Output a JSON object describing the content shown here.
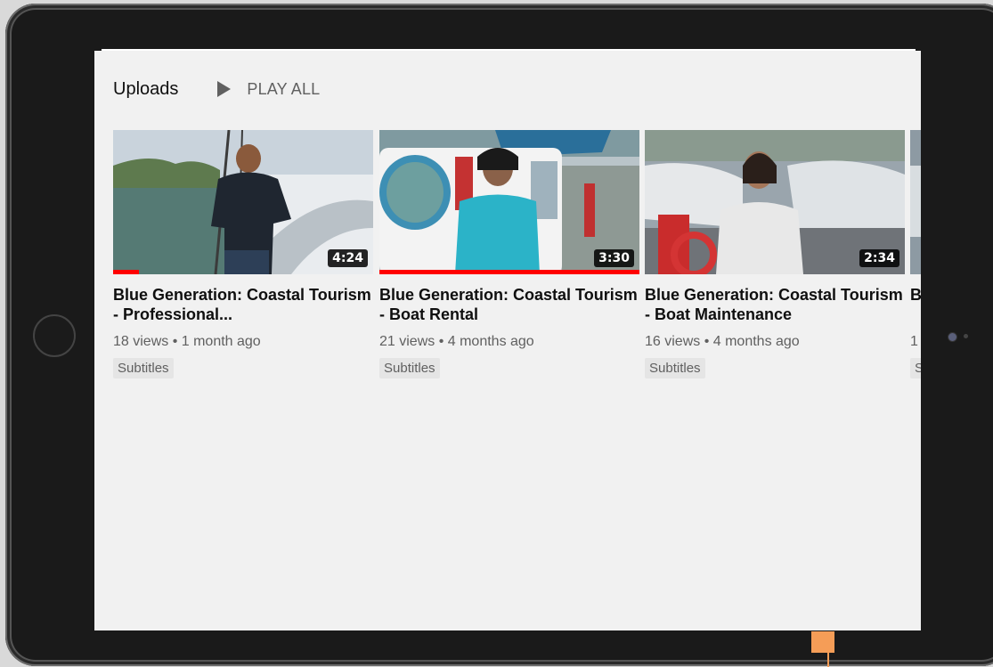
{
  "section": {
    "title": "Uploads",
    "play_all_label": "PLAY ALL"
  },
  "videos": [
    {
      "title": "Blue Generation: Coastal Tourism - Professional...",
      "duration": "4:24",
      "views": "18 views",
      "age": "1 month ago",
      "badge": "Subtitles",
      "watched_fraction": 0.1
    },
    {
      "title": "Blue Generation: Coastal Tourism - Boat Rental",
      "duration": "3:30",
      "views": "21 views",
      "age": "4 months ago",
      "badge": "Subtitles",
      "watched_fraction": 1.0
    },
    {
      "title": "Blue Generation: Coastal Tourism - Boat Maintenance",
      "duration": "2:34",
      "views": "16 views",
      "age": "4 months ago",
      "badge": "Subtitles",
      "watched_fraction": 0.0
    },
    {
      "title": "Blue Generation: Coastal Tourism",
      "duration": "",
      "views": "1",
      "age": "",
      "badge": "S",
      "watched_fraction": 0.0
    }
  ],
  "colors": {
    "progress": "#ff0000",
    "accent": "#f59d57"
  },
  "icons": {
    "play_all": "play-triangle-icon"
  }
}
